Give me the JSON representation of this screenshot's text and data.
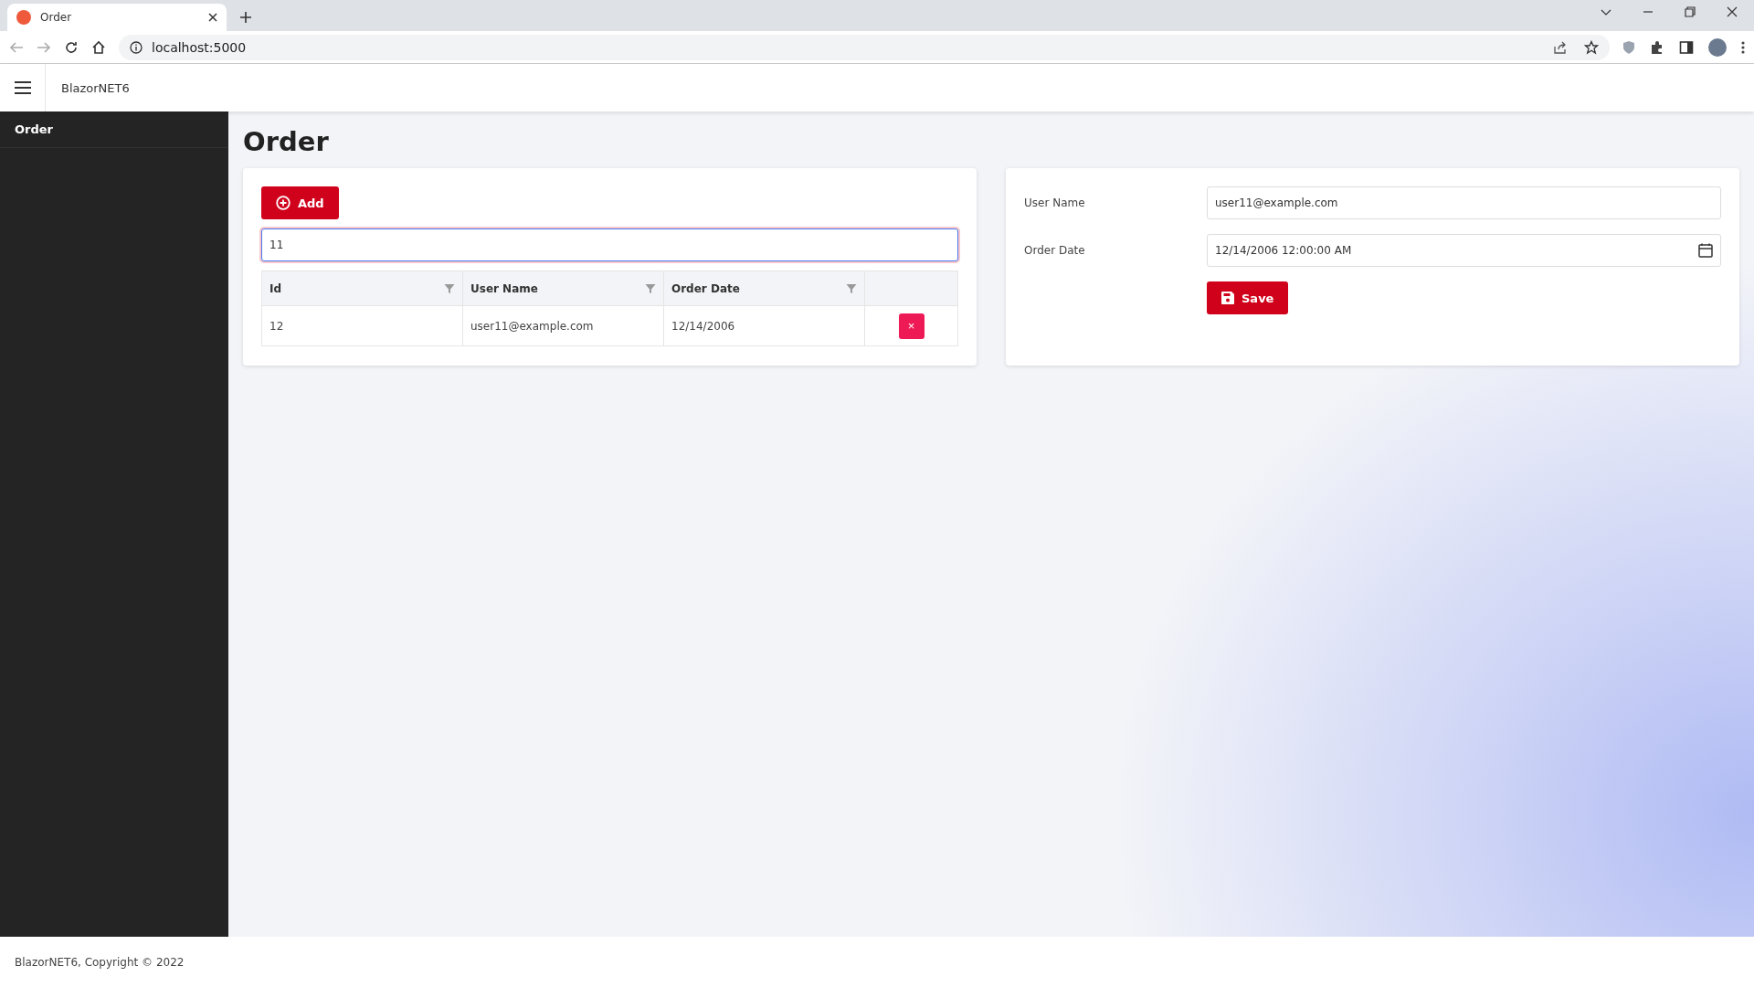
{
  "browser": {
    "tab_title": "Order",
    "address": "localhost:5000"
  },
  "app_header": {
    "title": "BlazorNET6"
  },
  "sidebar": {
    "items": [
      {
        "label": "Order",
        "selected": true
      }
    ]
  },
  "page_title": "Order",
  "order_list": {
    "add_button": "Add",
    "filter_field": {
      "value": "11",
      "focused": true
    },
    "table": {
      "columns": [
        "Id",
        "User Name",
        "Order Date"
      ],
      "rows": [
        {
          "cells": [
            "12",
            "user11@example.com",
            "12/14/2006"
          ],
          "delete_button": "×"
        }
      ]
    }
  },
  "order_form": {
    "fields": [
      {
        "label": "User Name",
        "value": "user11@example.com",
        "kind": "text"
      },
      {
        "label": "Order Date",
        "value": "12/14/2006 12:00:00 AM",
        "kind": "date"
      }
    ],
    "save_button": "Save"
  },
  "footer": "BlazorNET6, Copyright © 2022"
}
